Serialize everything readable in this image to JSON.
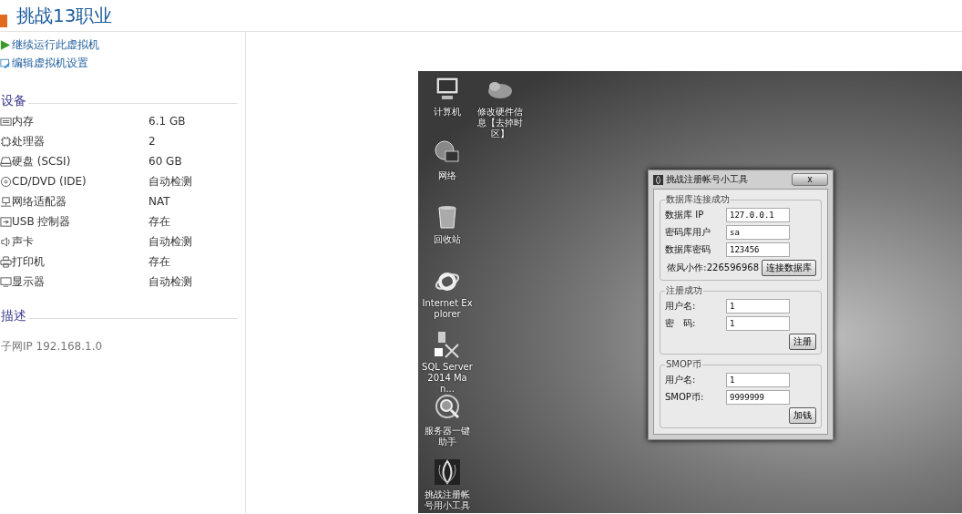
{
  "header": {
    "title": "挑战13职业"
  },
  "actions": [
    {
      "kind": "play",
      "label": "继续运行此虚拟机"
    },
    {
      "kind": "settings",
      "label": "编辑虚拟机设置"
    }
  ],
  "devices": {
    "title": "设备",
    "items": [
      {
        "kind": "memory",
        "name": "内存",
        "value": "6.1 GB"
      },
      {
        "kind": "cpu",
        "name": "处理器",
        "value": "2"
      },
      {
        "kind": "disk",
        "name": "硬盘 (SCSI)",
        "value": "60 GB"
      },
      {
        "kind": "cd",
        "name": "CD/DVD (IDE)",
        "value": "自动检测"
      },
      {
        "kind": "network",
        "name": "网络适配器",
        "value": "NAT"
      },
      {
        "kind": "usb",
        "name": "USB 控制器",
        "value": "存在"
      },
      {
        "kind": "sound",
        "name": "声卡",
        "value": "自动检测"
      },
      {
        "kind": "printer",
        "name": "打印机",
        "value": "存在"
      },
      {
        "kind": "display",
        "name": "显示器",
        "value": "自动检测"
      }
    ]
  },
  "description": {
    "title": "描述",
    "text": "子网IP 192.168.1.0"
  },
  "desktop": {
    "columns": [
      [
        {
          "kind": "computer",
          "label": "计算机"
        },
        {
          "kind": "network",
          "label": "网络"
        },
        {
          "kind": "recycle",
          "label": "回收站"
        },
        {
          "kind": "browser",
          "label": "Internet Explorer"
        },
        {
          "kind": "database",
          "label": "SQL Server 2014 Man..."
        },
        {
          "kind": "magnifier",
          "label": "服务器一键助手"
        },
        {
          "kind": "app",
          "label": "挑战注册帐号用小工具"
        }
      ],
      [
        {
          "kind": "tool",
          "label": "修改硬件信息【去掉时区】"
        }
      ]
    ]
  },
  "dialog": {
    "title": "挑战注册帐号小工具",
    "close": "x",
    "groups": [
      {
        "legend": "数据库连接成功",
        "fields": [
          {
            "label": "数据库 IP",
            "value": "127.0.0.1"
          },
          {
            "label": "密码库用户",
            "value": "sa"
          },
          {
            "label": "数据库密码",
            "value": "123456"
          }
        ],
        "note": "侬风小作:226596968",
        "button": "连接数据库"
      },
      {
        "legend": "注册成功",
        "fields": [
          {
            "label": "用户名:",
            "value": "1"
          },
          {
            "label": "密　码:",
            "value": "1"
          }
        ],
        "button": "注册"
      },
      {
        "legend": "SMOP币",
        "fields": [
          {
            "label": "用户名:",
            "value": "1"
          },
          {
            "label": "SMOP币:",
            "value": "9999999"
          }
        ],
        "button": "加钱"
      }
    ]
  }
}
